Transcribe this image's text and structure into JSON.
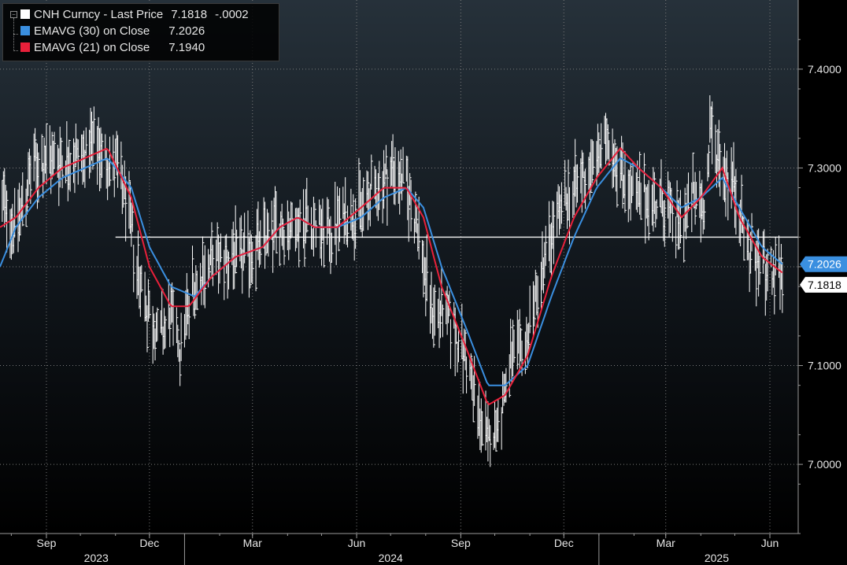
{
  "legend": {
    "items": [
      {
        "label": "CNH Curncy - Last Price",
        "value": "7.1818",
        "change": "-.0002",
        "color": "#ffffff"
      },
      {
        "label": "EMAVG (30)  on Close",
        "value": "7.2026",
        "color": "#3a8fe0"
      },
      {
        "label": "EMAVG (21)  on Close",
        "value": "7.1940",
        "color": "#e8203a"
      }
    ]
  },
  "tags": {
    "ema30": "7.2026",
    "last": "7.1818"
  },
  "chart_data": {
    "type": "line",
    "series": [
      {
        "name": "CNH Curncy - Last Price",
        "style": "hlc-bars",
        "color": "#ffffff",
        "anchors": [
          [
            "2023-07-22",
            7.27
          ],
          [
            "2023-08-05",
            7.24
          ],
          [
            "2023-08-20",
            7.3
          ],
          [
            "2023-09-08",
            7.31
          ],
          [
            "2023-09-25",
            7.31
          ],
          [
            "2023-10-15",
            7.32
          ],
          [
            "2023-11-01",
            7.3
          ],
          [
            "2023-11-10",
            7.27
          ],
          [
            "2023-11-22",
            7.19
          ],
          [
            "2023-12-01",
            7.15
          ],
          [
            "2023-12-10",
            7.13
          ],
          [
            "2023-12-20",
            7.15
          ],
          [
            "2023-12-28",
            7.12
          ],
          [
            "2024-01-08",
            7.18
          ],
          [
            "2024-01-20",
            7.2
          ],
          [
            "2024-02-05",
            7.21
          ],
          [
            "2024-02-20",
            7.21
          ],
          [
            "2024-03-05",
            7.22
          ],
          [
            "2024-03-20",
            7.24
          ],
          [
            "2024-04-05",
            7.24
          ],
          [
            "2024-04-20",
            7.25
          ],
          [
            "2024-05-05",
            7.23
          ],
          [
            "2024-05-20",
            7.25
          ],
          [
            "2024-06-05",
            7.26
          ],
          [
            "2024-06-20",
            7.28
          ],
          [
            "2024-07-03",
            7.3
          ],
          [
            "2024-07-15",
            7.28
          ],
          [
            "2024-07-25",
            7.24
          ],
          [
            "2024-08-05",
            7.16
          ],
          [
            "2024-08-20",
            7.15
          ],
          [
            "2024-09-05",
            7.11
          ],
          [
            "2024-09-15",
            7.06
          ],
          [
            "2024-09-25",
            7.02
          ],
          [
            "2024-10-05",
            7.05
          ],
          [
            "2024-10-15",
            7.1
          ],
          [
            "2024-10-28",
            7.12
          ],
          [
            "2024-11-10",
            7.19
          ],
          [
            "2024-11-25",
            7.25
          ],
          [
            "2024-12-10",
            7.28
          ],
          [
            "2024-12-25",
            7.3
          ],
          [
            "2025-01-10",
            7.33
          ],
          [
            "2025-01-20",
            7.3
          ],
          [
            "2025-02-01",
            7.27
          ],
          [
            "2025-02-15",
            7.27
          ],
          [
            "2025-03-01",
            7.26
          ],
          [
            "2025-03-15",
            7.24
          ],
          [
            "2025-03-25",
            7.27
          ],
          [
            "2025-04-05",
            7.26
          ],
          [
            "2025-04-10",
            7.34
          ],
          [
            "2025-04-20",
            7.3
          ],
          [
            "2025-05-01",
            7.28
          ],
          [
            "2025-05-12",
            7.22
          ],
          [
            "2025-05-25",
            7.2
          ],
          [
            "2025-06-05",
            7.19
          ],
          [
            "2025-06-12",
            7.1818
          ]
        ]
      },
      {
        "name": "EMAVG (30) on Close",
        "color": "#3a8fe0",
        "anchors": [
          [
            "2023-07-22",
            7.2
          ],
          [
            "2023-08-05",
            7.24
          ],
          [
            "2023-08-25",
            7.27
          ],
          [
            "2023-09-15",
            7.29
          ],
          [
            "2023-10-05",
            7.3
          ],
          [
            "2023-10-25",
            7.31
          ],
          [
            "2023-11-15",
            7.28
          ],
          [
            "2023-12-01",
            7.22
          ],
          [
            "2023-12-20",
            7.18
          ],
          [
            "2024-01-10",
            7.17
          ],
          [
            "2024-01-25",
            7.19
          ],
          [
            "2024-02-15",
            7.21
          ],
          [
            "2024-03-10",
            7.22
          ],
          [
            "2024-03-25",
            7.24
          ],
          [
            "2024-04-10",
            7.25
          ],
          [
            "2024-04-25",
            7.24
          ],
          [
            "2024-05-15",
            7.24
          ],
          [
            "2024-06-05",
            7.25
          ],
          [
            "2024-06-25",
            7.27
          ],
          [
            "2024-07-15",
            7.28
          ],
          [
            "2024-07-30",
            7.26
          ],
          [
            "2024-08-15",
            7.2
          ],
          [
            "2024-09-05",
            7.14
          ],
          [
            "2024-09-25",
            7.08
          ],
          [
            "2024-10-10",
            7.08
          ],
          [
            "2024-10-30",
            7.1
          ],
          [
            "2024-11-20",
            7.17
          ],
          [
            "2024-12-10",
            7.23
          ],
          [
            "2024-12-30",
            7.28
          ],
          [
            "2025-01-20",
            7.31
          ],
          [
            "2025-02-05",
            7.3
          ],
          [
            "2025-02-25",
            7.28
          ],
          [
            "2025-03-15",
            7.26
          ],
          [
            "2025-04-01",
            7.27
          ],
          [
            "2025-04-20",
            7.29
          ],
          [
            "2025-05-05",
            7.26
          ],
          [
            "2025-05-25",
            7.22
          ],
          [
            "2025-06-12",
            7.2026
          ]
        ]
      },
      {
        "name": "EMAVG (21) on Close",
        "color": "#e8203a",
        "anchors": [
          [
            "2023-07-22",
            7.24
          ],
          [
            "2023-08-05",
            7.25
          ],
          [
            "2023-08-25",
            7.28
          ],
          [
            "2023-09-15",
            7.3
          ],
          [
            "2023-10-05",
            7.31
          ],
          [
            "2023-10-25",
            7.32
          ],
          [
            "2023-11-15",
            7.27
          ],
          [
            "2023-12-01",
            7.2
          ],
          [
            "2023-12-20",
            7.16
          ],
          [
            "2024-01-05",
            7.16
          ],
          [
            "2024-01-25",
            7.19
          ],
          [
            "2024-02-15",
            7.21
          ],
          [
            "2024-03-10",
            7.22
          ],
          [
            "2024-03-25",
            7.24
          ],
          [
            "2024-04-10",
            7.25
          ],
          [
            "2024-04-25",
            7.24
          ],
          [
            "2024-05-15",
            7.24
          ],
          [
            "2024-06-05",
            7.26
          ],
          [
            "2024-06-25",
            7.28
          ],
          [
            "2024-07-15",
            7.28
          ],
          [
            "2024-07-30",
            7.25
          ],
          [
            "2024-08-15",
            7.18
          ],
          [
            "2024-09-05",
            7.12
          ],
          [
            "2024-09-25",
            7.06
          ],
          [
            "2024-10-10",
            7.07
          ],
          [
            "2024-10-30",
            7.11
          ],
          [
            "2024-11-20",
            7.19
          ],
          [
            "2024-12-10",
            7.25
          ],
          [
            "2024-12-30",
            7.29
          ],
          [
            "2025-01-20",
            7.32
          ],
          [
            "2025-02-05",
            7.3
          ],
          [
            "2025-02-25",
            7.28
          ],
          [
            "2025-03-15",
            7.25
          ],
          [
            "2025-04-01",
            7.27
          ],
          [
            "2025-04-20",
            7.3
          ],
          [
            "2025-05-05",
            7.25
          ],
          [
            "2025-05-25",
            7.21
          ],
          [
            "2025-06-12",
            7.194
          ]
        ]
      }
    ],
    "reference_line": {
      "y": 7.23,
      "from": "2023-11-01"
    },
    "xlim": [
      "2023-07-22",
      "2025-06-26"
    ],
    "ylim": [
      6.93,
      7.47
    ],
    "y_ticks": [
      "7.0000",
      "7.1000",
      "7.2000",
      "7.3000",
      "7.4000"
    ],
    "y_tick_values": [
      7.0,
      7.1,
      7.2,
      7.3,
      7.4
    ],
    "x_month_ticks": [
      {
        "date": "2023-09-01",
        "label": "Sep"
      },
      {
        "date": "2023-12-01",
        "label": "Dec"
      },
      {
        "date": "2024-03-01",
        "label": "Mar"
      },
      {
        "date": "2024-06-01",
        "label": "Jun"
      },
      {
        "date": "2024-09-01",
        "label": "Sep"
      },
      {
        "date": "2024-12-01",
        "label": "Dec"
      },
      {
        "date": "2025-03-01",
        "label": "Mar"
      },
      {
        "date": "2025-06-01",
        "label": "Jun"
      }
    ],
    "x_year_labels": [
      {
        "center": "2023-10-15",
        "label": "2023"
      },
      {
        "center": "2024-07-01",
        "label": "2024"
      },
      {
        "center": "2025-04-15",
        "label": "2025"
      }
    ],
    "x_year_dividers": [
      "2024-01-01",
      "2025-01-01"
    ],
    "grid": true,
    "legend_position": "top-left"
  }
}
